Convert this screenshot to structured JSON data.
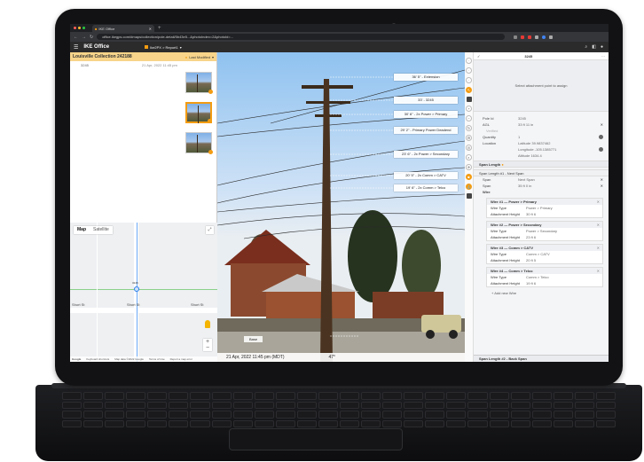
{
  "browser": {
    "tab_title": "IKE Office",
    "url": "office.ikegps.com/#maps/collection/pole-detail/5b43e5...&photoIndex=2&photoId=...",
    "colors": {
      "chrome_dark": "#1f2023",
      "address_bar": "#35363a"
    }
  },
  "app": {
    "brand": "IKE Office",
    "project": "Ike2PX > Report1",
    "accent": "#f39c12",
    "collection": {
      "title": "Louisville Collection 242188",
      "status": "Last Modified",
      "pole_id": "3245",
      "pole_date": "21 Apr, 2022 11:45 pm"
    }
  },
  "map": {
    "tab_map": "Map",
    "tab_satellite": "Satellite",
    "streets": [
      "Short St",
      "Short St",
      "Short St"
    ],
    "pole_label": "3245",
    "footer": [
      "Google",
      "Keyboard shortcuts",
      "Map data ©2022 Google",
      "Terms of Use",
      "Report a map error"
    ]
  },
  "photo": {
    "wire_labels": [
      "36' 5\" - Extension",
      "33' - 3245",
      "30' 6\" - 2x Power > Primary",
      "29' 2\" - Primary Power Deadend",
      "23' 6\" - 2x Power > Secondary",
      "20' 5\" - 2x Comm > CATV",
      "19' 6\" - 2x Comm > Telco"
    ],
    "base_label": "Base",
    "timestamp": "21 Apr, 2022 11:45 pm (MDT)",
    "angle": "47°"
  },
  "panel": {
    "pole_number": "3245",
    "select_point_text": "Select attachment point to assign",
    "fields": [
      {
        "key": "Pole Id",
        "value": "3245"
      },
      {
        "key": "AGL",
        "value": "33      ft  11   in"
      },
      {
        "key": "Verified",
        "value": ""
      },
      {
        "key": "Quantity",
        "value": "1"
      },
      {
        "key": "Location",
        "value": "Latitude   39.9837462"
      },
      {
        "key": "",
        "value": "Longitude  -105.1385771"
      },
      {
        "key": "",
        "value": "Altitude   1634.4"
      }
    ],
    "span_length_title": "Span Length",
    "span1_title": "Span Length #1 - Next Span",
    "span_fields": [
      {
        "key": "Span",
        "value": "Next Span"
      },
      {
        "key": "Span",
        "value": "35    ft  0   in"
      }
    ],
    "wires_label": "Wire",
    "wires": [
      {
        "title": "Wire #1 — Power > Primary",
        "type": "Power > Primary",
        "height": "30        ft   6"
      },
      {
        "title": "Wire #2 — Power > Secondary",
        "type": "Power > Secondary",
        "height": "23        ft   6"
      },
      {
        "title": "Wire #3 — Comm > CATV",
        "type": "Comm > CATV",
        "height": "20        ft   5"
      },
      {
        "title": "Wire #4 — Comm > Telco",
        "type": "Comm > Telco",
        "height": "19        ft   6"
      }
    ],
    "wire_type_label": "Wire Type",
    "attach_height_label": "Attachment Height",
    "add_wire": "+  Add new Wire",
    "span2_title": "Span Length #2 - Back Span"
  }
}
